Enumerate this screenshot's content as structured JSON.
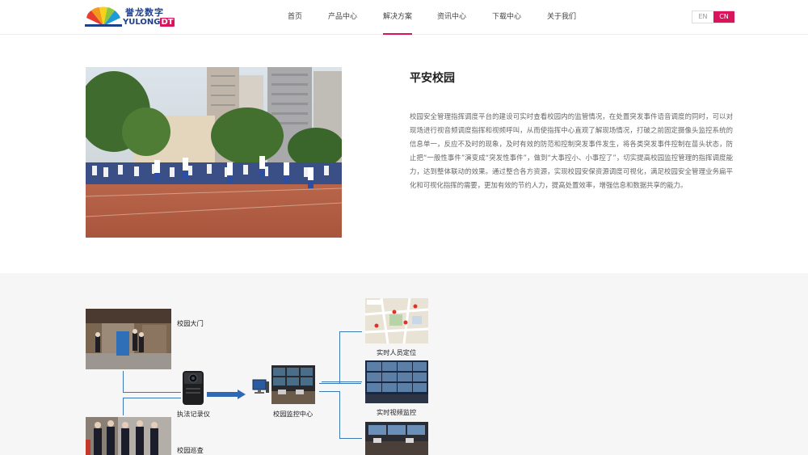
{
  "brand": {
    "cn_name": "誉龙数字",
    "en_name": "YULONG",
    "en_suffix": "DT"
  },
  "nav": [
    {
      "label": "首页",
      "active": false
    },
    {
      "label": "产品中心",
      "active": false
    },
    {
      "label": "解决方案",
      "active": true
    },
    {
      "label": "资讯中心",
      "active": false
    },
    {
      "label": "下载中心",
      "active": false
    },
    {
      "label": "关于我们",
      "active": false
    }
  ],
  "lang": {
    "en": "EN",
    "cn": "CN"
  },
  "article": {
    "title": "平安校园",
    "body": "校园安全管理指挥调度平台的建设可实时查看校园内的监管情况，在处置突发事件语音调度的同时，可以对现场进行视音频调度指挥和视频呼叫，从而使指挥中心直观了解现场情况，打破之前固定摄像头监控系统的信息单一，反应不及时的现象，及时有效的防范和控制突发事件发生，将各类突发事件控制在苗头状态，防止把“一般性事件”演变成“突发性事件”，做到“大事控小、小事控了”，切实提高校园监控管理的指挥调度能力，达到整体联动的效果。通过整合各方资源，实现校园安保资源调度可视化，满足校园安全管理业务扁平化和可视化指挥的需要，更加有效的节约人力，提高处置效率，增强信息和数据共享的能力。"
  },
  "diagram": {
    "gate": "校园大门",
    "patrol": "校园巡查",
    "recorder": "执法记录仪",
    "center": "校园监控中心",
    "locate": "实时人员定位",
    "video": "实时视频监控"
  },
  "colors": {
    "accent": "#d9145c",
    "brand_blue": "#1e3f8a",
    "line_blue": "#3c78b4"
  }
}
